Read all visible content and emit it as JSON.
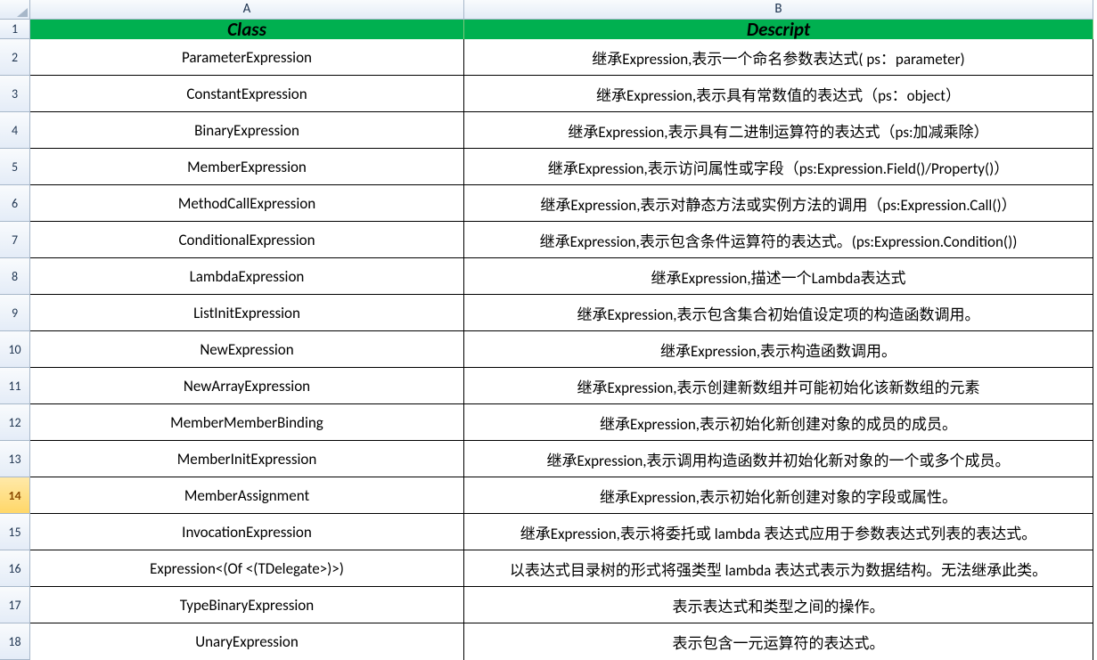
{
  "columns": {
    "col_letters": [
      "A",
      "B"
    ],
    "widths": [
      487,
      706
    ]
  },
  "row_header_width": 34,
  "selected_row": 14,
  "headers": {
    "A": "Class",
    "B": "Descript"
  },
  "rows": [
    {
      "num": 2,
      "class": "ParameterExpression",
      "descript": "继承Expression,表示一个命名参数表达式( ps：parameter)"
    },
    {
      "num": 3,
      "class": "ConstantExpression",
      "descript": "继承Expression,表示具有常数值的表达式（ps：object）"
    },
    {
      "num": 4,
      "class": "BinaryExpression",
      "descript": "继承Expression,表示具有二进制运算符的表达式（ps:加减乘除）"
    },
    {
      "num": 5,
      "class": "MemberExpression",
      "descript": "继承Expression,表示访问属性或字段（ps:Expression.Field()/Property()）"
    },
    {
      "num": 6,
      "class": "MethodCallExpression",
      "descript": "继承Expression,表示对静态方法或实例方法的调用（ps:Expression.Call()）"
    },
    {
      "num": 7,
      "class": "ConditionalExpression",
      "descript": "继承Expression,表示包含条件运算符的表达式。(ps:Expression.Condition())"
    },
    {
      "num": 8,
      "class": "LambdaExpression",
      "descript": "继承Expression,描述一个Lambda表达式"
    },
    {
      "num": 9,
      "class": "ListInitExpression",
      "descript": "继承Expression,表示包含集合初始值设定项的构造函数调用。"
    },
    {
      "num": 10,
      "class": "NewExpression",
      "descript": "继承Expression,表示构造函数调用。"
    },
    {
      "num": 11,
      "class": "NewArrayExpression",
      "descript": "继承Expression,表示创建新数组并可能初始化该新数组的元素"
    },
    {
      "num": 12,
      "class": "MemberMemberBinding",
      "descript": "继承Expression,表示初始化新创建对象的成员的成员。"
    },
    {
      "num": 13,
      "class": "MemberInitExpression",
      "descript": "继承Expression,表示调用构造函数并初始化新对象的一个或多个成员。"
    },
    {
      "num": 14,
      "class": "MemberAssignment",
      "descript": "继承Expression,表示初始化新创建对象的字段或属性。"
    },
    {
      "num": 15,
      "class": "InvocationExpression",
      "descript": "继承Expression,表示将委托或 lambda 表达式应用于参数表达式列表的表达式。"
    },
    {
      "num": 16,
      "class": "Expression<(Of <(TDelegate>)>)",
      "descript": "以表达式目录树的形式将强类型 lambda 表达式表示为数据结构。无法继承此类。"
    },
    {
      "num": 17,
      "class": "TypeBinaryExpression",
      "descript": "表示表达式和类型之间的操作。"
    },
    {
      "num": 18,
      "class": "UnaryExpression",
      "descript": "表示包含一元运算符的表达式。"
    }
  ]
}
